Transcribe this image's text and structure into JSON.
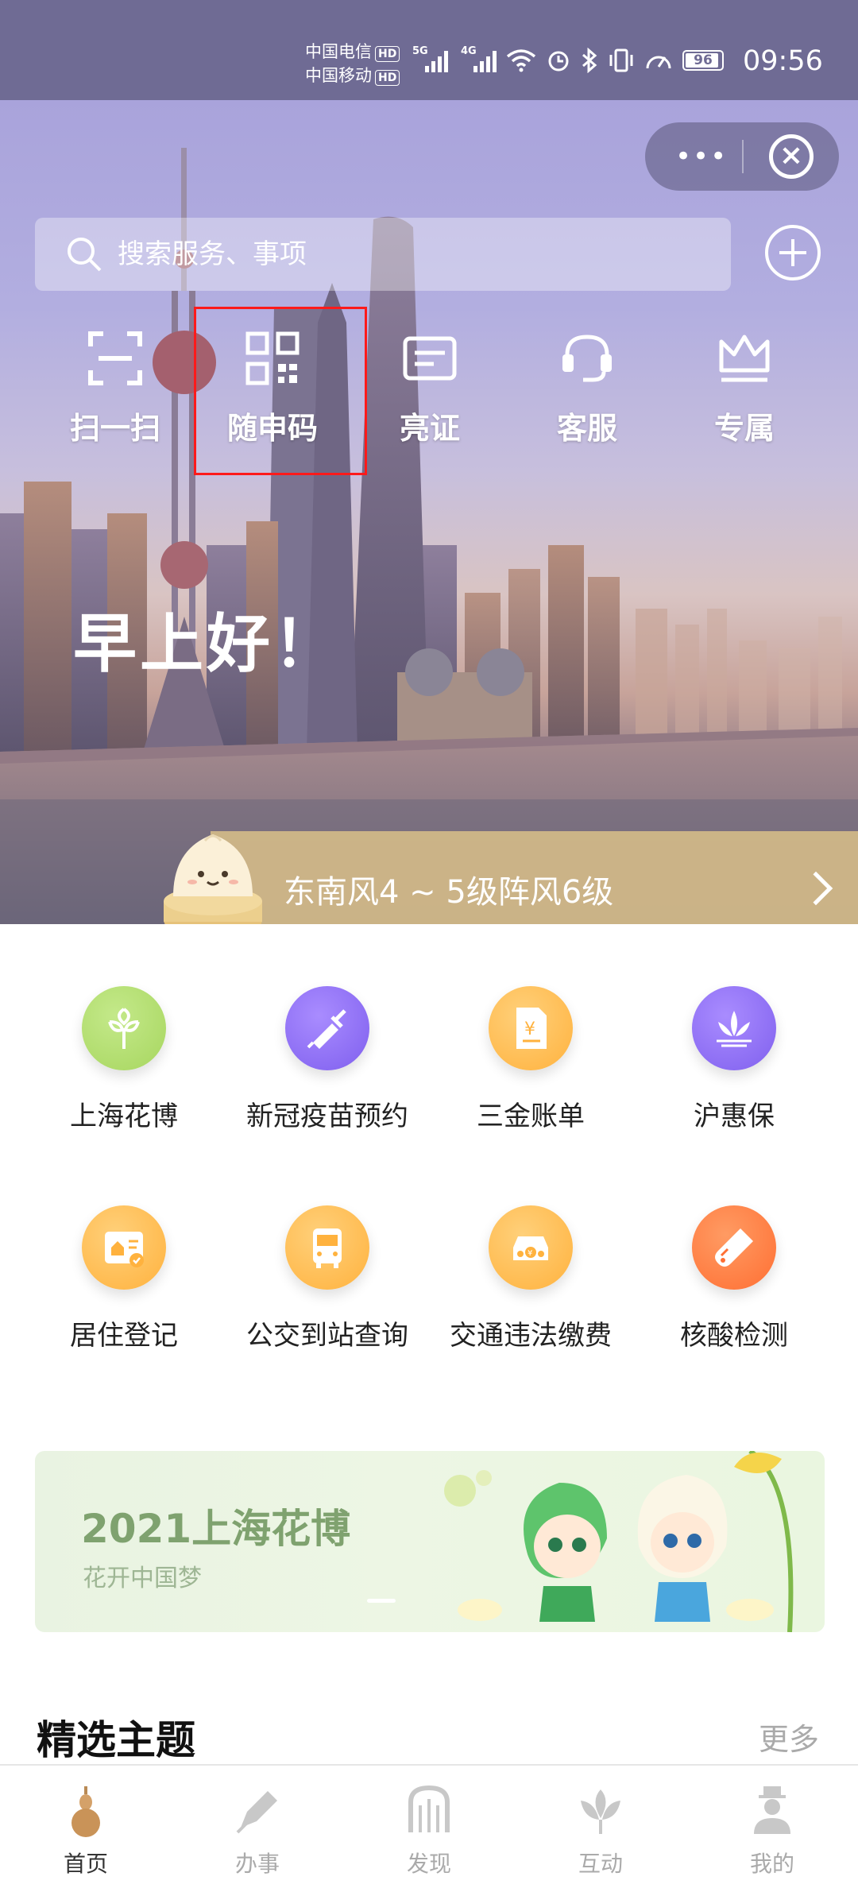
{
  "status_bar": {
    "carrier_1": "中国电信",
    "carrier_2": "中国移动",
    "hd_badge": "HD",
    "network_1": "5G",
    "network_2": "4G",
    "battery": "96",
    "time": "09:56"
  },
  "search": {
    "placeholder": "搜索服务、事项"
  },
  "quick_actions": [
    {
      "label": "扫一扫",
      "icon": "scan-icon"
    },
    {
      "label": "随申码",
      "icon": "qr-code-icon"
    },
    {
      "label": "亮证",
      "icon": "id-card-icon"
    },
    {
      "label": "客服",
      "icon": "headset-icon"
    },
    {
      "label": "专属",
      "icon": "crown-icon"
    }
  ],
  "greeting": "早上好！",
  "weather_text": "东南风4 ~ 5级阵风6级",
  "services": [
    {
      "label": "上海花博",
      "icon": "flower-expo-icon",
      "color": "#a7d65f"
    },
    {
      "label": "新冠疫苗预约",
      "icon": "syringe-icon",
      "color": "#8c6cf0"
    },
    {
      "label": "三金账单",
      "icon": "bill-icon",
      "color": "#ffb845"
    },
    {
      "label": "沪惠保",
      "icon": "lotus-icon",
      "color": "#8f6cf0"
    },
    {
      "label": "居住登记",
      "icon": "residence-icon",
      "color": "#ffb845"
    },
    {
      "label": "公交到站查询",
      "icon": "bus-icon",
      "color": "#ffb845"
    },
    {
      "label": "交通违法缴费",
      "icon": "car-fine-icon",
      "color": "#ffb845"
    },
    {
      "label": "核酸检测",
      "icon": "test-tube-icon",
      "color": "#ff7a3d"
    }
  ],
  "banner": {
    "title": "2021上海花博",
    "subtitle": "花开中国梦"
  },
  "section": {
    "title": "精选主题",
    "more": "更多"
  },
  "tabs": [
    {
      "label": "首页",
      "icon": "home-icon",
      "active": true
    },
    {
      "label": "办事",
      "icon": "pen-icon",
      "active": false
    },
    {
      "label": "发现",
      "icon": "discover-icon",
      "active": false
    },
    {
      "label": "互动",
      "icon": "interact-icon",
      "active": false
    },
    {
      "label": "我的",
      "icon": "profile-icon",
      "active": false
    }
  ]
}
